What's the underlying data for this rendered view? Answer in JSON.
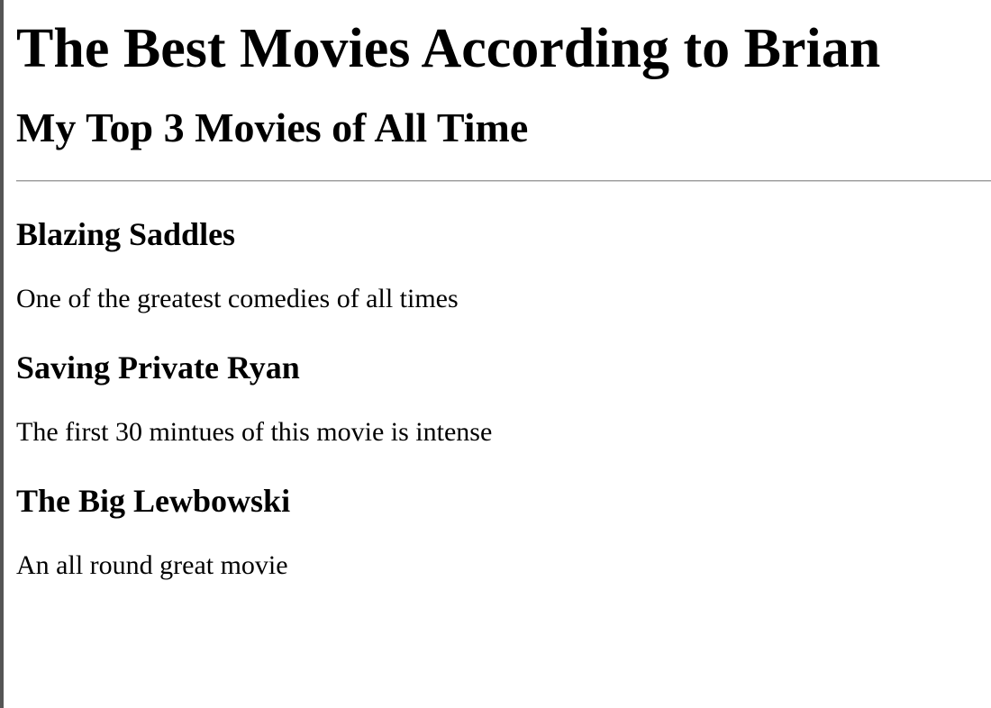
{
  "page": {
    "title": "The Best Movies According to Brian",
    "subtitle": "My Top 3 Movies of All Time"
  },
  "movies": [
    {
      "title": "Blazing Saddles",
      "description": "One of the greatest comedies of all times"
    },
    {
      "title": "Saving Private Ryan",
      "description": "The first 30 mintues of this movie is intense"
    },
    {
      "title": "The Big Lewbowski",
      "description": "An all round great movie"
    }
  ]
}
